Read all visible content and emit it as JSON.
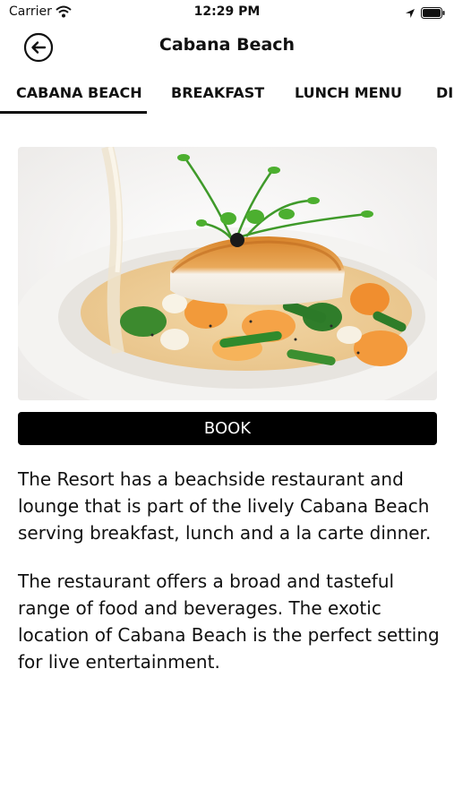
{
  "status_bar": {
    "carrier": "Carrier",
    "time": "12:29 PM",
    "icons": [
      "wifi-icon",
      "location-arrow-icon",
      "battery-icon"
    ]
  },
  "nav": {
    "title": "Cabana Beach",
    "back_icon": "back-arrow-icon"
  },
  "tabs": [
    {
      "label": "CABANA BEACH",
      "selected": true
    },
    {
      "label": "BREAKFAST",
      "selected": false
    },
    {
      "label": "LUNCH MENU",
      "selected": false
    },
    {
      "label": "DI",
      "selected": false
    }
  ],
  "hero": {
    "icon": "food-plate-image"
  },
  "book_button": {
    "label": "BOOK"
  },
  "description": {
    "paragraph_1": "The Resort has a beachside restaurant and lounge that is part of the lively Cabana Beach serving breakfast, lunch and a la carte dinner.",
    "paragraph_2": "The restaurant offers a broad and tasteful range of food and beverages. The exotic location of Cabana Beach is the perfect setting for live entertainment."
  },
  "colors": {
    "accent": "#000000",
    "background": "#ffffff",
    "text": "#111111"
  }
}
